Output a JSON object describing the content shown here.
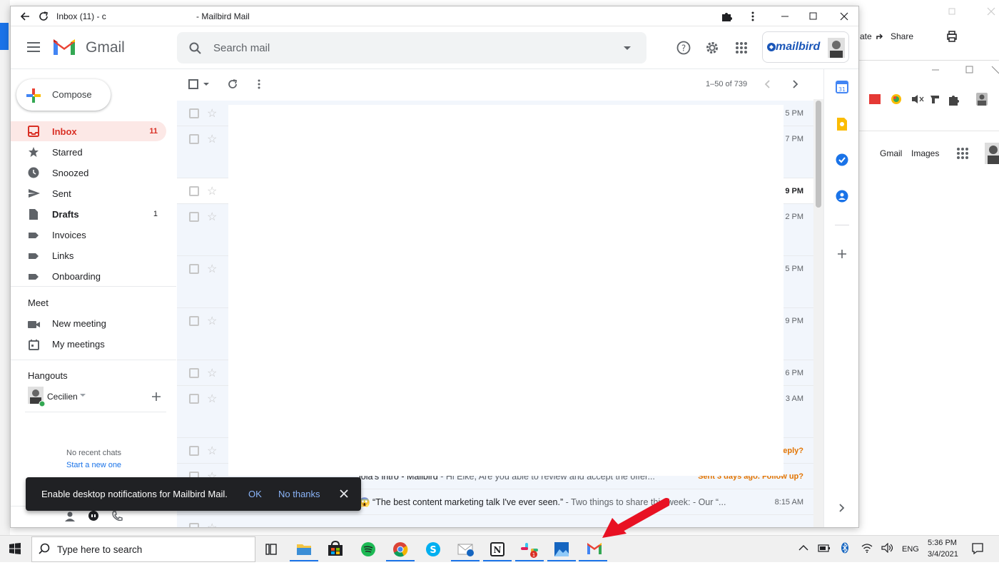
{
  "window": {
    "title_prefix": "Inbox (11) - c",
    "title_suffix": "- Mailbird Mail"
  },
  "header": {
    "product_name": "Gmail",
    "search_placeholder": "Search mail",
    "brand_badge": "mailbird"
  },
  "sidebar": {
    "compose_label": "Compose",
    "items": [
      {
        "label": "Inbox",
        "count": "11",
        "icon": "inbox-icon",
        "active": true,
        "bold": true
      },
      {
        "label": "Starred",
        "count": "",
        "icon": "star-icon"
      },
      {
        "label": "Snoozed",
        "count": "",
        "icon": "clock-icon"
      },
      {
        "label": "Sent",
        "count": "",
        "icon": "send-icon"
      },
      {
        "label": "Drafts",
        "count": "1",
        "icon": "draft-icon",
        "bold": true
      },
      {
        "label": "Invoices",
        "count": "",
        "icon": "label-icon"
      },
      {
        "label": "Links",
        "count": "",
        "icon": "label-icon"
      },
      {
        "label": "Onboarding",
        "count": "",
        "icon": "label-icon"
      }
    ],
    "meet": {
      "heading": "Meet",
      "new_meeting": "New meeting",
      "my_meetings": "My meetings"
    },
    "hangouts": {
      "heading": "Hangouts",
      "user": "Cecilien",
      "no_recent": "No recent chats",
      "start_new": "Start a new one"
    }
  },
  "mail_list": {
    "pager": "1–50 of 739",
    "rows": [
      {
        "time": "5 PM"
      },
      {
        "time": "7 PM"
      },
      {
        "time": "9 PM"
      },
      {
        "time": "2 PM"
      },
      {
        "time": "5 PM"
      },
      {
        "time": "9 PM"
      },
      {
        "time": "6 PM"
      },
      {
        "time": "3 AM"
      },
      {
        "time": "eply?"
      },
      {
        "snippet_subject": "iola's intro - Mailbird",
        "snippet_body": " - Hi Eike, Are you able to review and accept the offer...",
        "time": "Sent 3 days ago. Follow up?"
      },
      {
        "snippet_subject": "😱 “The best content marketing talk I've ever seen.”",
        "snippet_body": " - Two things to share this week: - Our “...",
        "time": "8:15 AM"
      }
    ]
  },
  "snackbar": {
    "message": "Enable desktop notifications for Mailbird Mail.",
    "ok": "OK",
    "no_thanks": "No thanks"
  },
  "background": {
    "share": "Share",
    "ate": "ate",
    "gmail_link": "Gmail",
    "images_link": "Images"
  },
  "taskbar": {
    "search_placeholder": "Type here to search",
    "language": "ENG",
    "time": "5:36 PM",
    "date": "3/4/2021"
  },
  "colors": {
    "gmail_red": "#d93025",
    "accent_blue": "#1a73e8",
    "arrow_red": "#e81123"
  }
}
